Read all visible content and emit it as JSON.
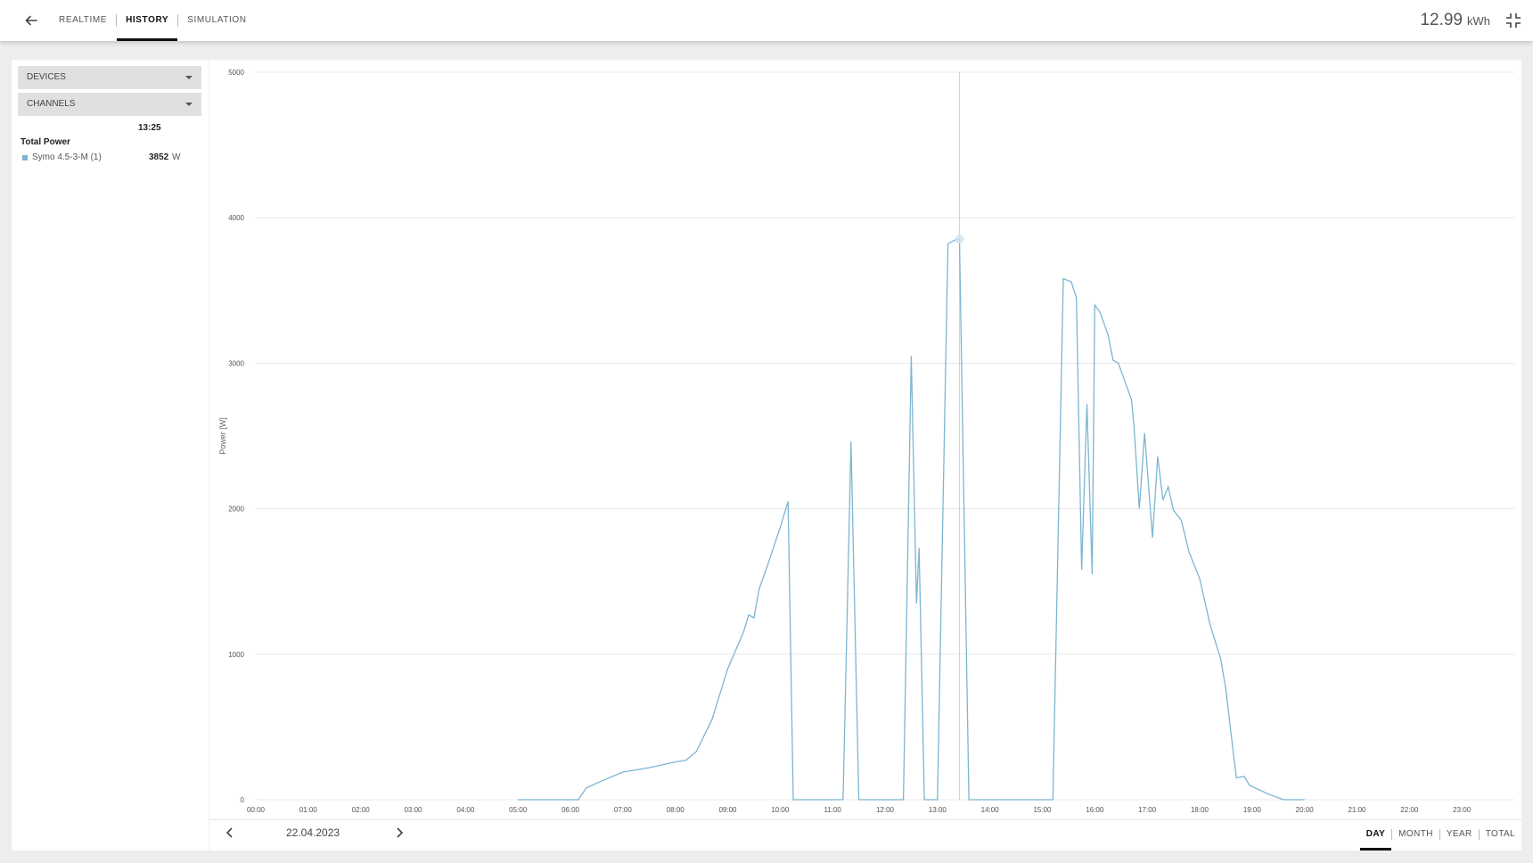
{
  "header": {
    "tabs": [
      {
        "label": "REALTIME",
        "active": false
      },
      {
        "label": "HISTORY",
        "active": true
      },
      {
        "label": "SIMULATION",
        "active": false
      }
    ],
    "energy_value": "12.99",
    "energy_unit": "kWh",
    "icons": {
      "back": "arrow-left-icon",
      "collapse": "fullscreen-exit-icon"
    }
  },
  "sidebar": {
    "devices_label": "DEVICES",
    "channels_label": "CHANNELS",
    "legend_time": "13:25",
    "legend_title": "Total Power",
    "legend_item": {
      "name": "Symo 4.5-3-M (1)",
      "value": "3852",
      "unit": "W",
      "color": "#7cb5d2"
    }
  },
  "footer": {
    "date": "22.04.2023",
    "periods": [
      "DAY",
      "MONTH",
      "YEAR",
      "TOTAL"
    ],
    "active_period": "DAY"
  },
  "chart_data": {
    "type": "line",
    "ylabel": "Power [W]",
    "ylim": [
      0,
      5000
    ],
    "yticks": [
      0,
      1000,
      2000,
      3000,
      4000,
      5000
    ],
    "xlim": [
      0,
      24
    ],
    "xticks": [
      "00:00",
      "01:00",
      "02:00",
      "03:00",
      "04:00",
      "05:00",
      "06:00",
      "07:00",
      "08:00",
      "09:00",
      "10:00",
      "11:00",
      "12:00",
      "13:00",
      "14:00",
      "15:00",
      "16:00",
      "17:00",
      "18:00",
      "19:00",
      "20:00",
      "21:00",
      "22:00",
      "23:00"
    ],
    "grid": true,
    "crosshair_x": 13.42,
    "series": [
      {
        "color": "#7cb5d2",
        "points": [
          [
            5.0,
            0
          ],
          [
            6.15,
            0
          ],
          [
            6.3,
            80
          ],
          [
            6.6,
            130
          ],
          [
            7.0,
            190
          ],
          [
            7.5,
            220
          ],
          [
            8.0,
            260
          ],
          [
            8.2,
            270
          ],
          [
            8.4,
            330
          ],
          [
            8.7,
            550
          ],
          [
            9.0,
            900
          ],
          [
            9.3,
            1150
          ],
          [
            9.4,
            1270
          ],
          [
            9.5,
            1250
          ],
          [
            9.6,
            1450
          ],
          [
            9.75,
            1600
          ],
          [
            10.0,
            1870
          ],
          [
            10.15,
            2050
          ],
          [
            10.25,
            0
          ],
          [
            11.2,
            0
          ],
          [
            11.35,
            2460
          ],
          [
            11.5,
            0
          ],
          [
            12.35,
            0
          ],
          [
            12.5,
            3050
          ],
          [
            12.6,
            1350
          ],
          [
            12.65,
            1730
          ],
          [
            12.75,
            0
          ],
          [
            13.0,
            0
          ],
          [
            13.2,
            3820
          ],
          [
            13.35,
            3850
          ],
          [
            13.42,
            3852
          ],
          [
            13.6,
            0
          ],
          [
            15.2,
            0
          ],
          [
            15.4,
            3580
          ],
          [
            15.55,
            3560
          ],
          [
            15.65,
            3450
          ],
          [
            15.75,
            1580
          ],
          [
            15.85,
            2720
          ],
          [
            15.95,
            1550
          ],
          [
            16.0,
            3400
          ],
          [
            16.1,
            3350
          ],
          [
            16.25,
            3200
          ],
          [
            16.35,
            3020
          ],
          [
            16.45,
            3000
          ],
          [
            16.7,
            2750
          ],
          [
            16.75,
            2550
          ],
          [
            16.85,
            2000
          ],
          [
            16.95,
            2520
          ],
          [
            17.1,
            1800
          ],
          [
            17.2,
            2360
          ],
          [
            17.3,
            2060
          ],
          [
            17.4,
            2150
          ],
          [
            17.5,
            1990
          ],
          [
            17.65,
            1920
          ],
          [
            17.8,
            1700
          ],
          [
            18.0,
            1520
          ],
          [
            18.2,
            1200
          ],
          [
            18.4,
            970
          ],
          [
            18.5,
            760
          ],
          [
            18.6,
            450
          ],
          [
            18.7,
            150
          ],
          [
            18.85,
            160
          ],
          [
            18.95,
            100
          ],
          [
            19.3,
            40
          ],
          [
            19.6,
            0
          ],
          [
            20.0,
            0
          ]
        ]
      }
    ]
  }
}
